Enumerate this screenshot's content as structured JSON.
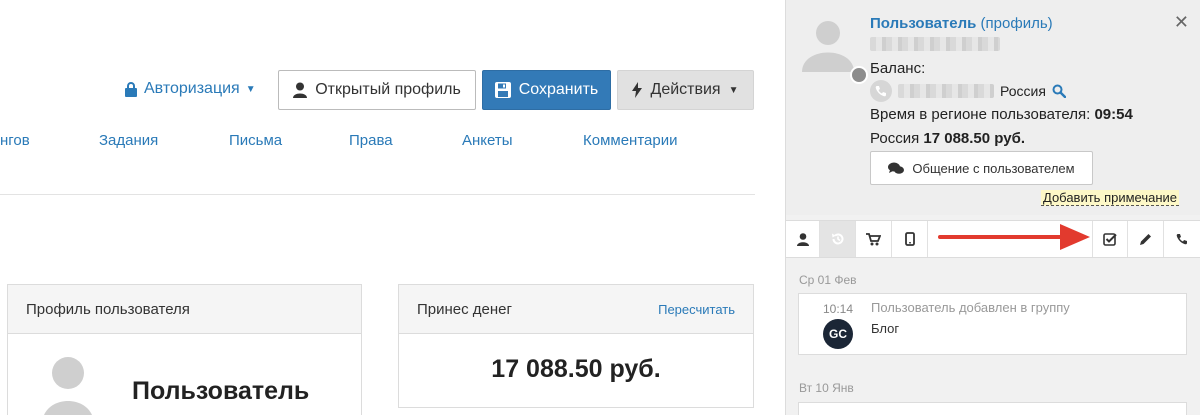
{
  "toolbar": {
    "auth_label": "Авторизация",
    "open_profile_label": "Открытый профиль",
    "save_label": "Сохранить",
    "actions_label": "Действия"
  },
  "tabs": [
    {
      "label": "нгов"
    },
    {
      "label": "Задания"
    },
    {
      "label": "Письма"
    },
    {
      "label": "Права"
    },
    {
      "label": "Анкеты"
    },
    {
      "label": "Комментарии"
    }
  ],
  "profile_panel": {
    "title": "Профиль пользователя",
    "name": "Пользователь"
  },
  "money_panel": {
    "title": "Принес денег",
    "recalc_label": "Пересчитать",
    "value": "17 088.50 руб."
  },
  "side": {
    "user_label": "Пользователь",
    "profile_label": "(профиль)",
    "balance_label": "Баланс:",
    "country": "Россия",
    "time_label": "Время в регионе пользователя:",
    "time_value": "09:54",
    "amount_country": "Россия",
    "amount_value": "17 088.50 руб.",
    "chat_button_label": "Общение с пользователем",
    "add_note_label": "Добавить примечание"
  },
  "feed": [
    {
      "date": "Ср 01 Фев",
      "time": "10:14",
      "title": "Пользователь добавлен в группу",
      "description": "Блог",
      "badge": "GC"
    },
    {
      "date": "Вт 10 Янв"
    }
  ],
  "colors": {
    "link": "#2a7ab8",
    "save_button": "#337ab7",
    "actions_button": "#e1e1e1",
    "arrow": "#e23a2e",
    "note_highlight": "#fdf8c7"
  }
}
